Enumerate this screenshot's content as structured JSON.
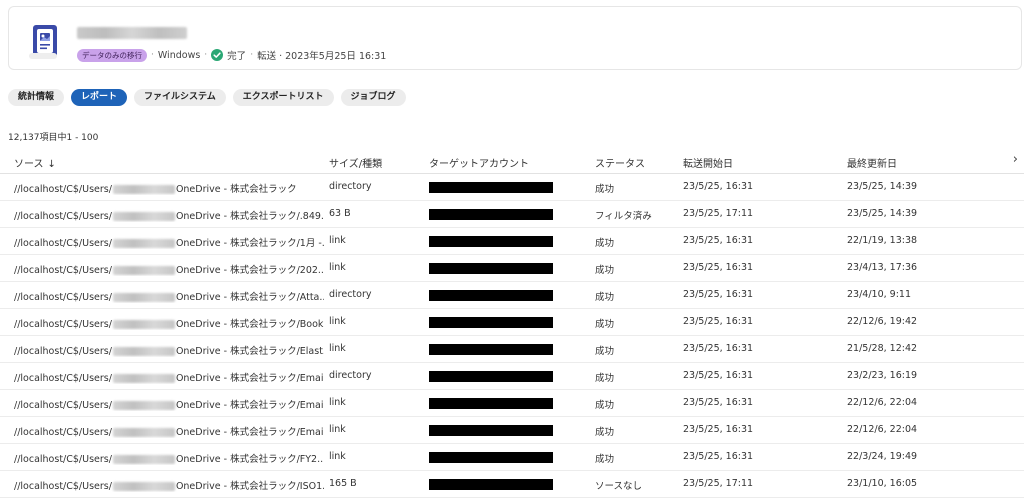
{
  "header": {
    "badge": "データのみの移行",
    "os": "Windows",
    "status": "完了",
    "transfer": "転送 · 2023年5月25日 16:31",
    "separator": "·",
    "colors": {
      "badge_bg": "#c9a2ea",
      "check": "#2aa774",
      "icon": "#3a4aa8"
    }
  },
  "tabs": [
    {
      "label": "統計情報",
      "active": false
    },
    {
      "label": "レポート",
      "active": true
    },
    {
      "label": "ファイルシステム",
      "active": false
    },
    {
      "label": "エクスポートリスト",
      "active": false
    },
    {
      "label": "ジョブログ",
      "active": false
    }
  ],
  "count_text": "12,137項目中1 - 100",
  "columns": {
    "source": "ソース",
    "source_sort": "↓",
    "size": "サイズ/種類",
    "target": "ターゲットアカウント",
    "status": "ステータス",
    "start": "転送開始日",
    "updated": "最終更新日",
    "scroll": "›"
  },
  "rows": [
    {
      "src_prefix": "//localhost/C$/Users/",
      "src_suffix": "OneDrive - 株式会社ラック",
      "size": "directory",
      "status": "成功",
      "start": "23/5/25, 16:31",
      "updated": "23/5/25, 14:39"
    },
    {
      "src_prefix": "//localhost/C$/Users/",
      "src_suffix": "OneDrive - 株式会社ラック/.849...",
      "size": "63 B",
      "status": "フィルタ済み",
      "start": "23/5/25, 17:11",
      "updated": "23/5/25, 14:39"
    },
    {
      "src_prefix": "//localhost/C$/Users/",
      "src_suffix": "OneDrive - 株式会社ラック/1月 -...",
      "size": "link",
      "status": "成功",
      "start": "23/5/25, 16:31",
      "updated": "22/1/19, 13:38"
    },
    {
      "src_prefix": "//localhost/C$/Users/",
      "src_suffix": "OneDrive - 株式会社ラック/202...",
      "size": "link",
      "status": "成功",
      "start": "23/5/25, 16:31",
      "updated": "23/4/13, 17:36"
    },
    {
      "src_prefix": "//localhost/C$/Users/",
      "src_suffix": "OneDrive - 株式会社ラック/Atta...",
      "size": "directory",
      "status": "成功",
      "start": "23/5/25, 16:31",
      "updated": "23/4/10, 9:11"
    },
    {
      "src_prefix": "//localhost/C$/Users/",
      "src_suffix": "OneDrive - 株式会社ラック/Book...",
      "size": "link",
      "status": "成功",
      "start": "23/5/25, 16:31",
      "updated": "22/12/6, 19:42"
    },
    {
      "src_prefix": "//localhost/C$/Users/",
      "src_suffix": "OneDrive - 株式会社ラック/Elast...",
      "size": "link",
      "status": "成功",
      "start": "23/5/25, 16:31",
      "updated": "21/5/28, 12:42"
    },
    {
      "src_prefix": "//localhost/C$/Users/",
      "src_suffix": "OneDrive - 株式会社ラック/Emai...",
      "size": "directory",
      "status": "成功",
      "start": "23/5/25, 16:31",
      "updated": "23/2/23, 16:19"
    },
    {
      "src_prefix": "//localhost/C$/Users/",
      "src_suffix": "OneDrive - 株式会社ラック/Emai...",
      "size": "link",
      "status": "成功",
      "start": "23/5/25, 16:31",
      "updated": "22/12/6, 22:04"
    },
    {
      "src_prefix": "//localhost/C$/Users/",
      "src_suffix": "OneDrive - 株式会社ラック/Emai...",
      "size": "link",
      "status": "成功",
      "start": "23/5/25, 16:31",
      "updated": "22/12/6, 22:04"
    },
    {
      "src_prefix": "//localhost/C$/Users/",
      "src_suffix": "OneDrive - 株式会社ラック/FY2...",
      "size": "link",
      "status": "成功",
      "start": "23/5/25, 16:31",
      "updated": "22/3/24, 19:49"
    },
    {
      "src_prefix": "//localhost/C$/Users/",
      "src_suffix": "OneDrive - 株式会社ラック/ISO1...",
      "size": "165 B",
      "status": "ソースなし",
      "start": "23/5/25, 17:11",
      "updated": "23/1/10, 16:05"
    }
  ]
}
